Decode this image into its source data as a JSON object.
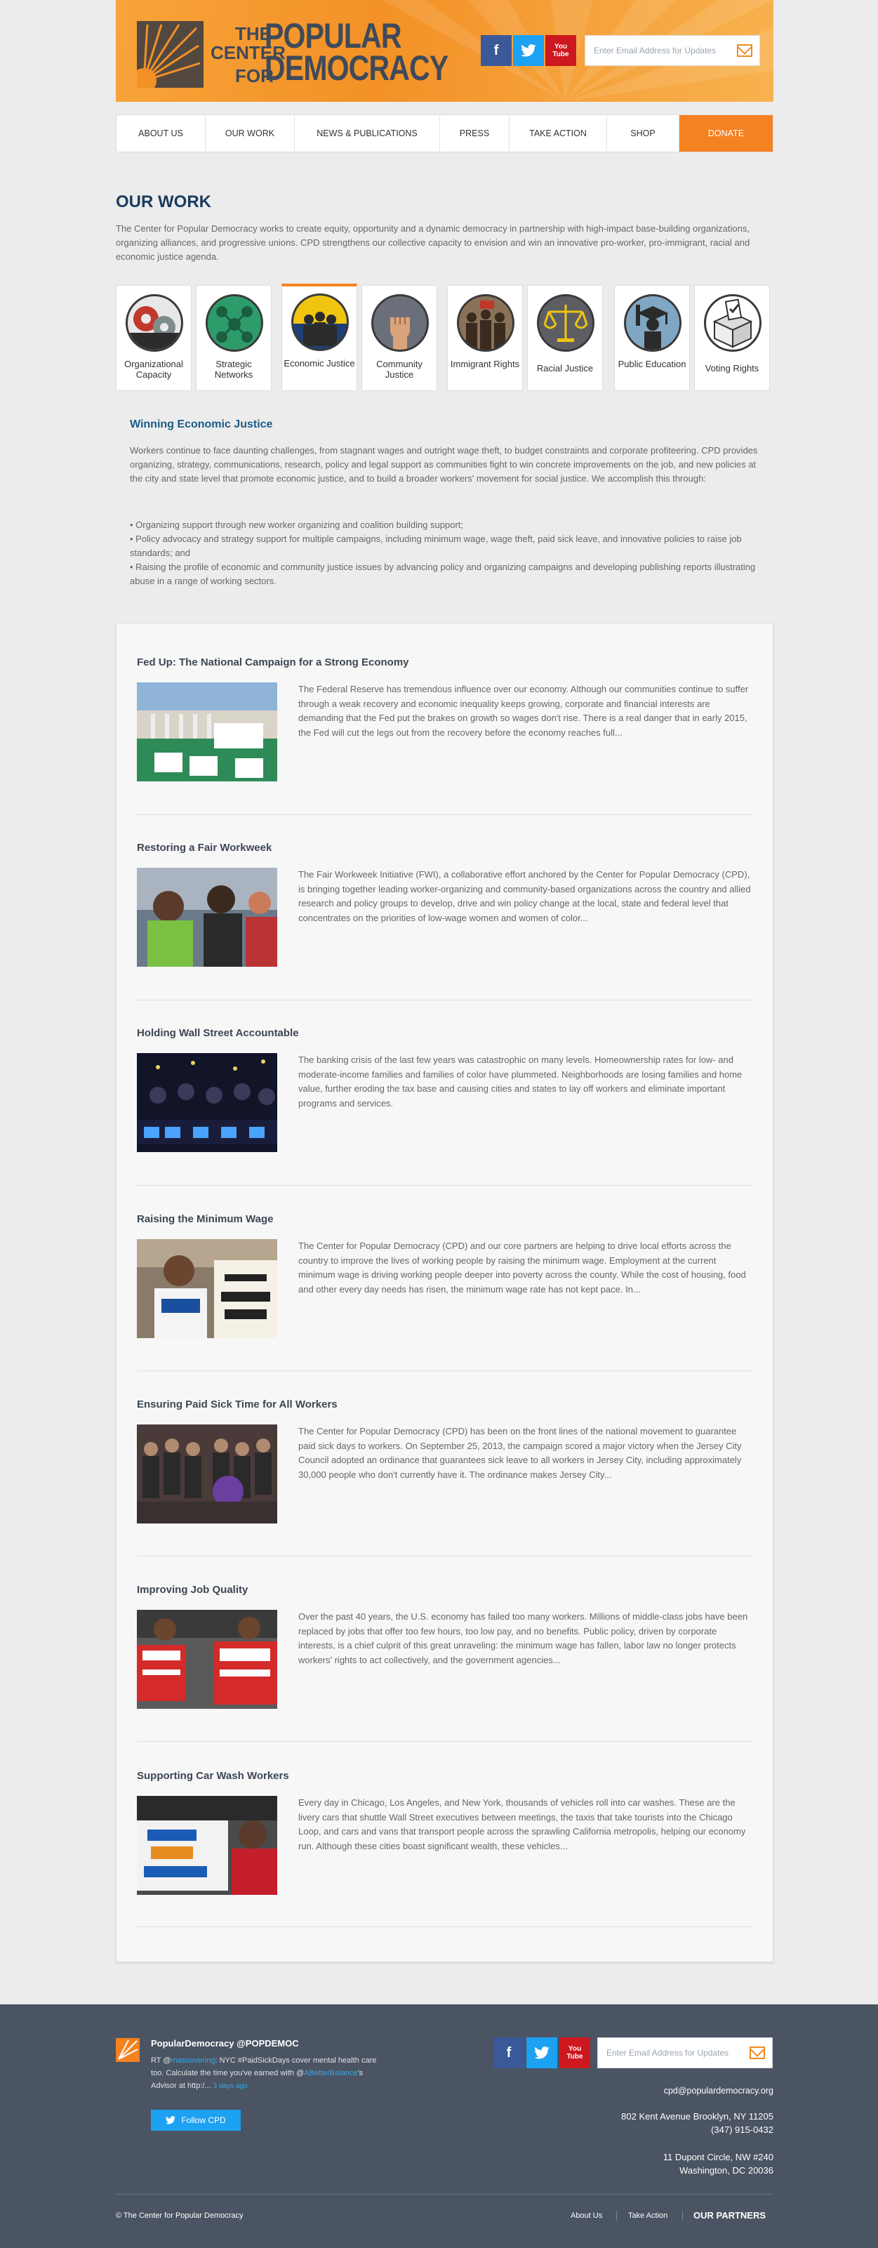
{
  "header": {
    "logo": {
      "line_the": "THE",
      "line_center": "CENTER",
      "line_for": "FOR",
      "line_popular": "POPULAR",
      "line_democracy": "DEMOCRACY"
    },
    "social": [
      {
        "name": "facebook",
        "glyph": "f"
      },
      {
        "name": "twitter",
        "glyph": "t"
      },
      {
        "name": "youtube",
        "glyph": "You Tube"
      }
    ],
    "email_placeholder": "Enter Email Address for Updates"
  },
  "nav": {
    "items": [
      "ABOUT US",
      "OUR WORK",
      "NEWS & PUBLICATIONS",
      "PRESS",
      "TAKE ACTION",
      "SHOP",
      "DONATE"
    ]
  },
  "our_work": {
    "title": "OUR WORK",
    "intro": "The Center for Popular Democracy works to create equity, opportunity and a dynamic democracy in partnership with high-impact base-building organizations, organizing alliances, and progressive unions. CPD strengthens our collective capacity to envision and win an innovative pro-worker, pro-immigrant, racial and economic justice agenda."
  },
  "categories": [
    {
      "label": "Organizational Capacity",
      "icon": "gears-icon",
      "bg": "#e8e8e8"
    },
    {
      "label": "Strategic Networks",
      "icon": "network-icon",
      "bg": "#2e9c6a"
    },
    {
      "label": "Economic Justice",
      "icon": "workers-icon",
      "bg": "#1e3f76"
    },
    {
      "label": "Community Justice",
      "icon": "fist-icon",
      "bg": "#6b6f7a"
    },
    {
      "label": "Immigrant Rights",
      "icon": "crowd-icon",
      "bg": "#8a7258"
    },
    {
      "label": "Racial Justice",
      "icon": "scales-icon",
      "bg": "#5c5e64"
    },
    {
      "label": "Public Education",
      "icon": "graduate-icon",
      "bg": "#7fa7c4"
    },
    {
      "label": "Voting Rights",
      "icon": "ballot-box-icon",
      "bg": "#ffffff"
    }
  ],
  "winning": {
    "title": "Winning Economic Justice",
    "body": "Workers continue to face daunting challenges, from stagnant wages and outright wage theft, to budget constraints and corporate profiteering. CPD provides organizing, strategy, communications, research, policy and legal support as communities fight to win concrete improvements on the job, and new policies at the city and state level that promote economic justice, and to build a broader workers' movement for social justice. We accomplish this through:",
    "bullets": [
      "• Organizing support through new worker organizing and coalition building support;",
      "• Policy advocacy and strategy support for multiple campaigns, including minimum wage, wage theft, paid sick leave, and innovative policies to raise job standards; and",
      "• Raising the profile of economic and community justice issues by advancing policy and organizing campaigns and developing publishing reports illustrating abuse in a range of working sectors."
    ]
  },
  "articles": [
    {
      "title": "Fed Up: The National Campaign for a Strong Economy",
      "body": "The Federal Reserve has tremendous influence over our economy. Although our communities continue to suffer through a weak recovery and economic inequality keeps growing, corporate and financial interests are demanding that the Fed put the brakes on growth so wages don't rise. There is a real danger that in early 2015, the Fed will cut the legs out from the recovery before the economy reaches full...",
      "img": "fed-rally-photo"
    },
    {
      "title": "Restoring a Fair Workweek",
      "body": "The Fair Workweek Initiative (FWI), a collaborative effort anchored by the Center for Popular Democracy (CPD), is bringing together leading worker-organizing and community-based organizations across the country and allied research and policy groups to develop, drive and win policy change at the local, state and federal level that concentrates on the priorities of low-wage women and women of color...",
      "img": "workweek-meeting-photo"
    },
    {
      "title": "Holding Wall Street Accountable",
      "body": "The banking crisis of the last few years was catastrophic on many levels. Homeownership rates for low- and moderate-income families and families of color have plummeted. Neighborhoods are losing families and home value, further eroding the tax base and causing cities and states to lay off workers and eliminate important programs and services.",
      "img": "wall-street-protest-photo"
    },
    {
      "title": "Raising the Minimum Wage",
      "body": "The Center for Popular Democracy (CPD) and our core partners are helping to drive local efforts across the country to improve the lives of working people by raising the minimum wage. Employment at the current minimum wage is driving working people deeper into poverty across the county. While the cost of housing, food and other every day needs has risen, the minimum wage rate has not kept pace. In...",
      "img": "minimum-wage-sign-photo"
    },
    {
      "title": "Ensuring Paid Sick Time for All Workers",
      "body": "The Center for Popular Democracy (CPD) has been on the front lines of the national movement to guarantee paid sick days to workers. On September 25, 2013, the campaign scored a major victory when the Jersey City Council adopted an ordinance that guarantees sick leave to all workers in Jersey City, including approximately 30,000 people who don't currently have it. The ordinance makes Jersey City...",
      "img": "sick-time-group-photo"
    },
    {
      "title": "Improving Job Quality",
      "body": "Over the past 40 years, the U.S. economy has failed too many workers. Millions of middle-class jobs have been replaced by jobs that offer too few hours, too low pay, and no benefits. Public policy, driven by corporate interests, is a chief culprit of this great unraveling: the minimum wage has fallen, labor law no longer protects workers' rights to act collectively, and the government agencies...",
      "img": "strike-signs-photo"
    },
    {
      "title": "Supporting Car Wash Workers",
      "body": "Every day in Chicago, Los Angeles, and New York, thousands of vehicles roll into car washes. These are the livery cars that shuttle Wall Street executives between meetings, the taxis that take tourists into the Chicago Loop, and cars and vans that transport people across the sprawling California metropolis, helping our economy run. Although these cities boast significant wealth, these vehicles...",
      "img": "car-wash-rally-photo"
    }
  ],
  "footer": {
    "handle": "PopularDemocracy @POPDEMOC",
    "tweet_pre": "RT @",
    "tweet_user1": "masoovering",
    "tweet_mid": ": NYC #PaidSickDays cover mental health care too. Calculate the time you've earned with @",
    "tweet_user2": "ABetterBalance",
    "tweet_post": "'s Advisor at http:/... ",
    "tweet_time": "3 days ago",
    "follow_label": "Follow CPD",
    "email_placeholder": "Enter Email Address for Updates",
    "contact_email": "cpd@populardemocracy.org",
    "address1_line1": "802 Kent Avenue Brooklyn, NY 11205",
    "address1_line2": "(347) 915-0432",
    "address2_line1": "11 Dupont Circle, NW #240",
    "address2_line2": "Washington, DC 20036",
    "copyright": "© The Center for Popular Democracy",
    "links": [
      "About Us",
      "Take Action"
    ],
    "partners": "OUR PARTNERS"
  }
}
